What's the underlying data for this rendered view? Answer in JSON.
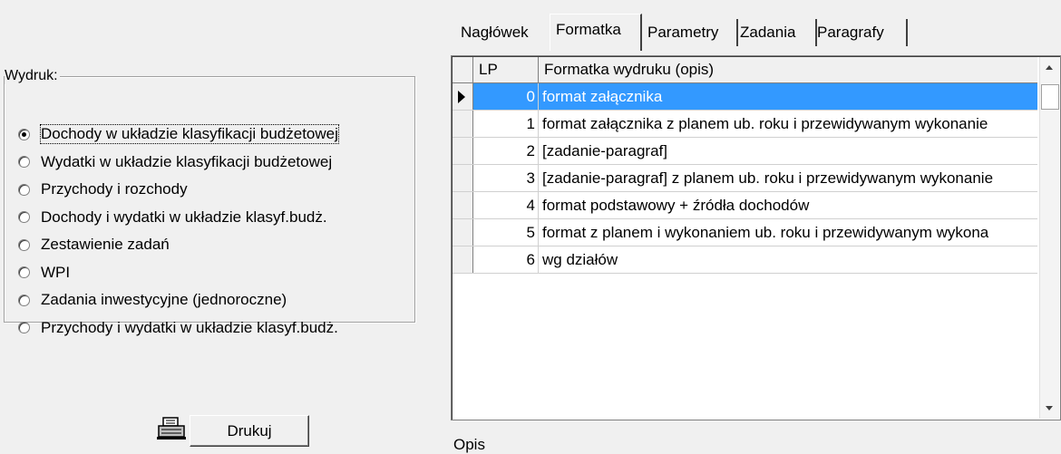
{
  "print_group": {
    "legend": "Wydruk:",
    "options": [
      {
        "label": "Dochody w układzie klasyfikacji budżetowej",
        "selected": true
      },
      {
        "label": "Wydatki w układzie klasyfikacji budżetowej",
        "selected": false
      },
      {
        "label": "Przychody i rozchody",
        "selected": false
      },
      {
        "label": "Dochody i wydatki w układzie klasyf.budż.",
        "selected": false
      },
      {
        "label": "Zestawienie zadań",
        "selected": false
      },
      {
        "label": "WPI",
        "selected": false
      },
      {
        "label": "Zadania inwestycyjne (jednoroczne)",
        "selected": false
      },
      {
        "label": "Przychody i wydatki w układzie klasyf.budż.",
        "selected": false
      }
    ]
  },
  "print_button": {
    "label": "Drukuj",
    "icon": "printer-icon"
  },
  "tabs": [
    {
      "label": "Nagłówek",
      "active": false
    },
    {
      "label": "Formatka",
      "active": true
    },
    {
      "label": "Parametry",
      "active": false
    },
    {
      "label": "Zadania",
      "active": false
    },
    {
      "label": "Paragrafy",
      "active": false
    }
  ],
  "grid": {
    "columns": [
      "LP",
      "Formatka wydruku (opis)"
    ],
    "selected_row": 0,
    "rows": [
      {
        "lp": "0",
        "desc": "format załącznika"
      },
      {
        "lp": "1",
        "desc": "format załącznika z planem ub. roku i przewidywanym wykonanie"
      },
      {
        "lp": "2",
        "desc": "[zadanie-paragraf]"
      },
      {
        "lp": "3",
        "desc": "[zadanie-paragraf] z planem ub. roku i przewidywanym wykonanie"
      },
      {
        "lp": "4",
        "desc": "format podstawowy + źródła dochodów"
      },
      {
        "lp": "5",
        "desc": "format z planem i wykonaniem ub. roku i przewidywanym wykona"
      },
      {
        "lp": "6",
        "desc": "wg działów"
      }
    ]
  },
  "opis_label": "Opis"
}
